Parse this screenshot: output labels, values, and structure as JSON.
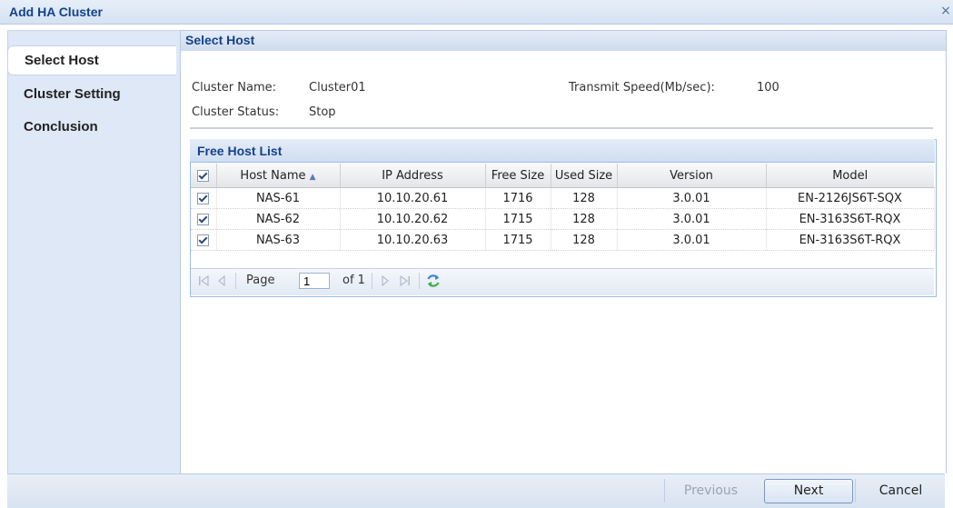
{
  "window": {
    "title": "Add HA Cluster",
    "close_glyph": "×"
  },
  "steps": [
    {
      "label": "Select Host",
      "active": true
    },
    {
      "label": "Cluster Setting",
      "active": false
    },
    {
      "label": "Conclusion",
      "active": false
    }
  ],
  "main": {
    "title": "Select Host",
    "cluster_name_label": "Cluster Name:",
    "cluster_name_value": "Cluster01",
    "transmit_speed_label": "Transmit Speed(Mb/sec):",
    "transmit_speed_value": "100",
    "cluster_status_label": "Cluster Status:",
    "cluster_status_value": "Stop"
  },
  "grid": {
    "title": "Free Host List",
    "columns": [
      "Host Name",
      "IP Address",
      "Free Size",
      "Used Size",
      "Version",
      "Model"
    ],
    "sort_indicator": "▲",
    "rows": [
      {
        "host": "NAS-61",
        "ip": "10.10.20.61",
        "free": "1716",
        "used": "128",
        "version": "3.0.01",
        "model": "EN-2126JS6T-SQX"
      },
      {
        "host": "NAS-62",
        "ip": "10.10.20.62",
        "free": "1715",
        "used": "128",
        "version": "3.0.01",
        "model": "EN-3163S6T-RQX"
      },
      {
        "host": "NAS-63",
        "ip": "10.10.20.63",
        "free": "1715",
        "used": "128",
        "version": "3.0.01",
        "model": "EN-3163S6T-RQX"
      }
    ]
  },
  "pager": {
    "page_label": "Page",
    "page_value": "1",
    "of_label": "of 1",
    "icons": [
      "first-page-icon",
      "prev-page-icon",
      "next-page-icon",
      "last-page-icon",
      "refresh-icon"
    ]
  },
  "footer": {
    "previous_label": "Previous",
    "next_label": "Next",
    "cancel_label": "Cancel"
  },
  "colors": {
    "accent": "#15428b",
    "panel": "#dfe8f6",
    "border": "#99bbe8"
  }
}
